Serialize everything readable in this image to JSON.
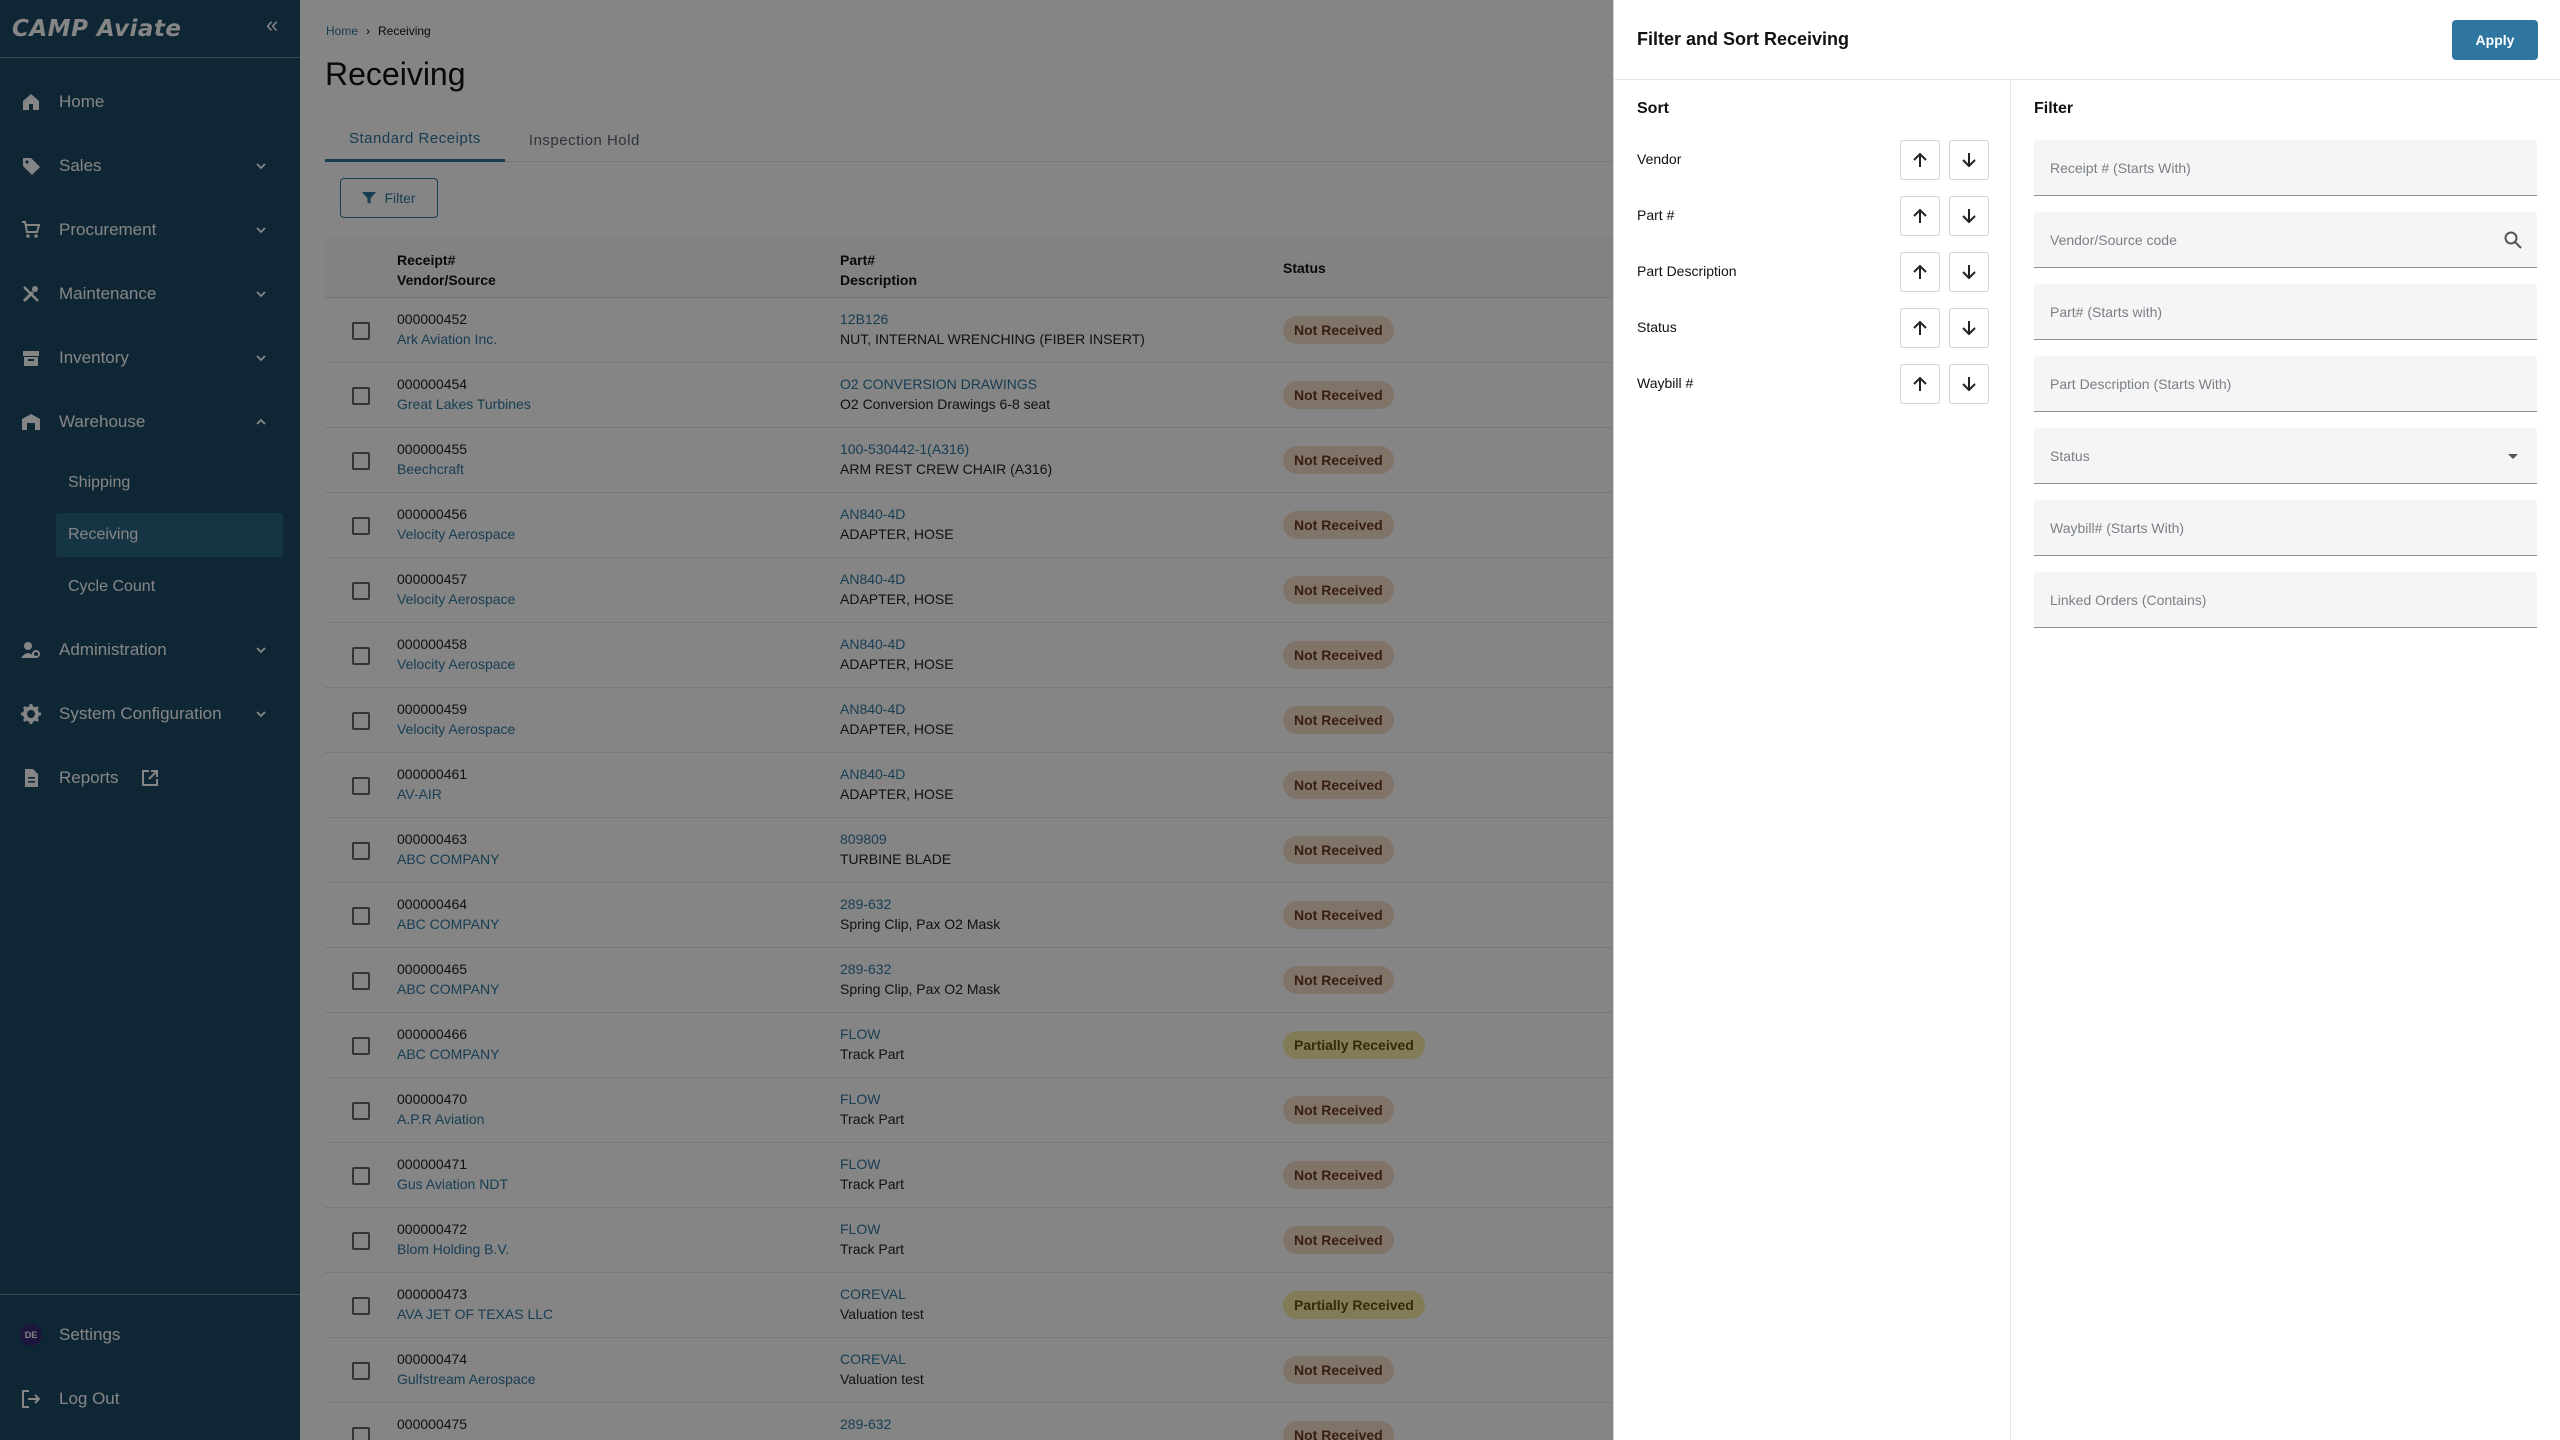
{
  "sidebar": {
    "logo": "CAMP Aviate",
    "items": [
      {
        "label": "Home",
        "icon": "home-icon"
      },
      {
        "label": "Sales",
        "icon": "tag-icon"
      },
      {
        "label": "Procurement",
        "icon": "cart-icon"
      },
      {
        "label": "Maintenance",
        "icon": "tools-icon"
      },
      {
        "label": "Inventory",
        "icon": "inventory-icon"
      },
      {
        "label": "Warehouse",
        "icon": "warehouse-icon"
      },
      {
        "label": "Administration",
        "icon": "admin-icon"
      },
      {
        "label": "System Configuration",
        "icon": "gear-icon"
      },
      {
        "label": "Reports",
        "icon": "report-icon"
      }
    ],
    "warehouse_sub": [
      "Shipping",
      "Receiving",
      "Cycle Count"
    ],
    "bottom": {
      "settings": "Settings",
      "avatar": "DE",
      "logout": "Log Out"
    }
  },
  "main": {
    "breadcrumb": {
      "home": "Home",
      "current": "Receiving"
    },
    "title": "Receiving",
    "tabs": [
      "Standard Receipts",
      "Inspection Hold"
    ],
    "filter_label": "Filter",
    "headers": {
      "col1a": "Receipt#",
      "col1b": "Vendor/Source",
      "col2a": "Part#",
      "col2b": "Description",
      "col3": "Status"
    },
    "rows": [
      {
        "receipt": "000000452",
        "vendor": "Ark Aviation Inc.",
        "part": "12B126",
        "desc": "NUT, INTERNAL WRENCHING (FIBER INSERT)",
        "status": "Not Received"
      },
      {
        "receipt": "000000454",
        "vendor": "Great Lakes Turbines",
        "part": "O2 CONVERSION DRAWINGS",
        "desc": "O2 Conversion Drawings 6-8 seat",
        "status": "Not Received"
      },
      {
        "receipt": "000000455",
        "vendor": "Beechcraft",
        "part": "100-530442-1(A316)",
        "desc": "ARM REST CREW CHAIR (A316)",
        "status": "Not Received"
      },
      {
        "receipt": "000000456",
        "vendor": "Velocity Aerospace",
        "part": "AN840-4D",
        "desc": "ADAPTER, HOSE",
        "status": "Not Received"
      },
      {
        "receipt": "000000457",
        "vendor": "Velocity Aerospace",
        "part": "AN840-4D",
        "desc": "ADAPTER, HOSE",
        "status": "Not Received"
      },
      {
        "receipt": "000000458",
        "vendor": "Velocity Aerospace",
        "part": "AN840-4D",
        "desc": "ADAPTER, HOSE",
        "status": "Not Received"
      },
      {
        "receipt": "000000459",
        "vendor": "Velocity Aerospace",
        "part": "AN840-4D",
        "desc": "ADAPTER, HOSE",
        "status": "Not Received"
      },
      {
        "receipt": "000000461",
        "vendor": "AV-AIR",
        "part": "AN840-4D",
        "desc": "ADAPTER, HOSE",
        "status": "Not Received"
      },
      {
        "receipt": "000000463",
        "vendor": "ABC COMPANY",
        "part": "809809",
        "desc": "TURBINE BLADE",
        "status": "Not Received"
      },
      {
        "receipt": "000000464",
        "vendor": "ABC COMPANY",
        "part": "289-632",
        "desc": "Spring Clip, Pax O2 Mask",
        "status": "Not Received"
      },
      {
        "receipt": "000000465",
        "vendor": "ABC COMPANY",
        "part": "289-632",
        "desc": "Spring Clip, Pax O2 Mask",
        "status": "Not Received"
      },
      {
        "receipt": "000000466",
        "vendor": "ABC COMPANY",
        "part": "FLOW",
        "desc": "Track Part",
        "status": "Partially Received"
      },
      {
        "receipt": "000000470",
        "vendor": "A.P.R Aviation",
        "part": "FLOW",
        "desc": "Track Part",
        "status": "Not Received"
      },
      {
        "receipt": "000000471",
        "vendor": "Gus Aviation NDT",
        "part": "FLOW",
        "desc": "Track Part",
        "status": "Not Received"
      },
      {
        "receipt": "000000472",
        "vendor": "Blom Holding B.V.",
        "part": "FLOW",
        "desc": "Track Part",
        "status": "Not Received"
      },
      {
        "receipt": "000000473",
        "vendor": "AVA JET OF TEXAS LLC",
        "part": "COREVAL",
        "desc": "Valuation test",
        "status": "Partially Received"
      },
      {
        "receipt": "000000474",
        "vendor": "Gulfstream Aerospace",
        "part": "COREVAL",
        "desc": "Valuation test",
        "status": "Not Received"
      },
      {
        "receipt": "000000475",
        "vendor": "",
        "part": "289-632",
        "desc": "",
        "status": "Not Received"
      }
    ]
  },
  "panel": {
    "title": "Filter and Sort Receiving",
    "apply": "Apply",
    "sort_title": "Sort",
    "sort_fields": [
      "Vendor",
      "Part #",
      "Part Description",
      "Status",
      "Waybill #"
    ],
    "filter_title": "Filter",
    "filter_fields": [
      "Receipt # (Starts With)",
      "Vendor/Source code",
      "Part# (Starts with)",
      "Part Description (Starts With)",
      "Status",
      "Waybill# (Starts With)",
      "Linked Orders (Contains)"
    ]
  },
  "colors": {
    "sidebar": "#1e4c66",
    "accent": "#2f77a1",
    "not_received": "#f6dcc8",
    "partially_received": "#f7eca6"
  }
}
